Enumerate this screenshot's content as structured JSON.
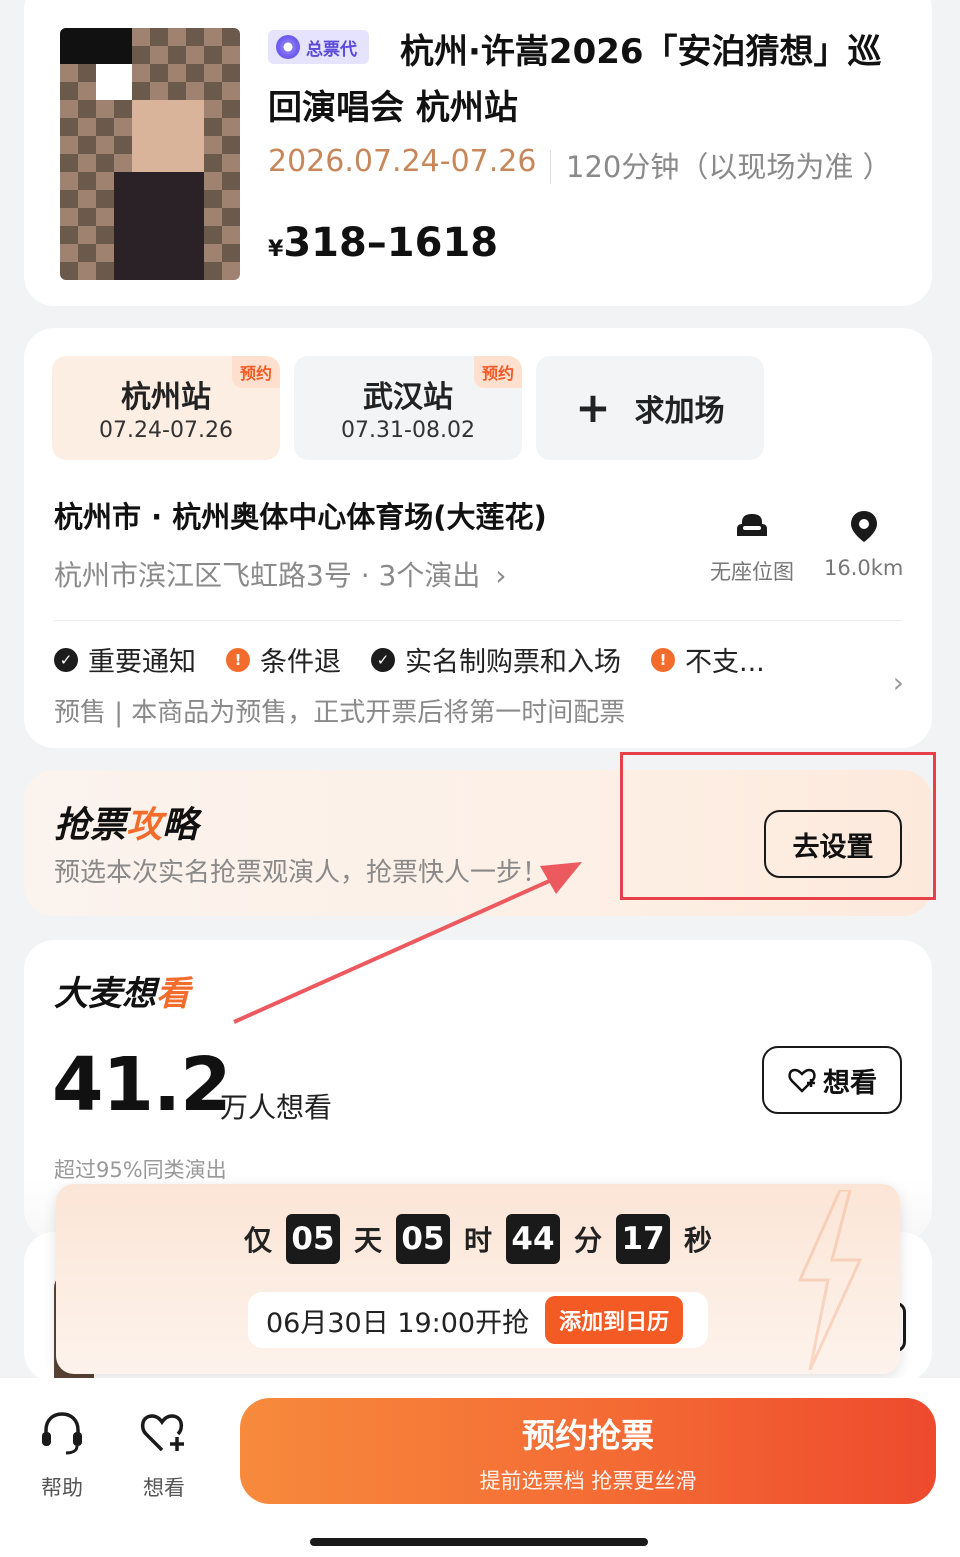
{
  "event": {
    "badge": "总票代",
    "title": "杭州·许嵩2026「安泊猜想」巡回演唱会 杭州站",
    "date": "2026.07.24-07.26",
    "duration": "120分钟（以现场为准 ）",
    "currency": "¥",
    "price_range": "318–1618"
  },
  "stations": [
    {
      "name": "杭州站",
      "date": "07.24-07.26",
      "tag": "预约",
      "active": true
    },
    {
      "name": "武汉站",
      "date": "07.31-08.02",
      "tag": "预约",
      "active": false
    }
  ],
  "add_show": {
    "icon": "plus-icon",
    "label": "求加场"
  },
  "venue": {
    "name": "杭州市 · 杭州奥体中心体育场(大莲花)",
    "address": "杭州市滨江区飞虹路3号 · 3个演出",
    "seat_map_label": "无座位图",
    "distance": "16.0km"
  },
  "notices": [
    {
      "icon": "check",
      "label": "重要通知"
    },
    {
      "icon": "warning",
      "label": "条件退"
    },
    {
      "icon": "check",
      "label": "实名制购票和入场"
    },
    {
      "icon": "warning",
      "label": "不支..."
    }
  ],
  "presale_text": "预售 | 本商品为预售，正式开票后将第一时间配票",
  "strategy": {
    "title_a": "抢票",
    "title_b": "攻",
    "title_c": "略",
    "subtitle": "预选本次实名抢票观演人，抢票快人一步！",
    "button": "去设置"
  },
  "want": {
    "title_a": "大麦想",
    "title_b": "看",
    "count": "41.2",
    "unit": "万人想看",
    "exceed": "超过95%同类演出",
    "button": "想看"
  },
  "countdown": {
    "prefix": "仅",
    "days": "05",
    "days_unit": "天",
    "hours": "05",
    "hours_unit": "时",
    "minutes": "44",
    "minutes_unit": "分",
    "seconds": "17",
    "seconds_unit": "秒",
    "start_time": "06月30日 19:00开抢",
    "calendar_button": "添加到日历"
  },
  "bottom": {
    "help": "帮助",
    "want": "想看",
    "cta_main": "预约抢票",
    "cta_sub": "提前选票档 抢票更丝滑"
  },
  "colors": {
    "accent": "#f36c2c",
    "date_brown": "#c8875a",
    "badge_purple": "#5b4ad8",
    "annotation_red": "#e8404a"
  }
}
